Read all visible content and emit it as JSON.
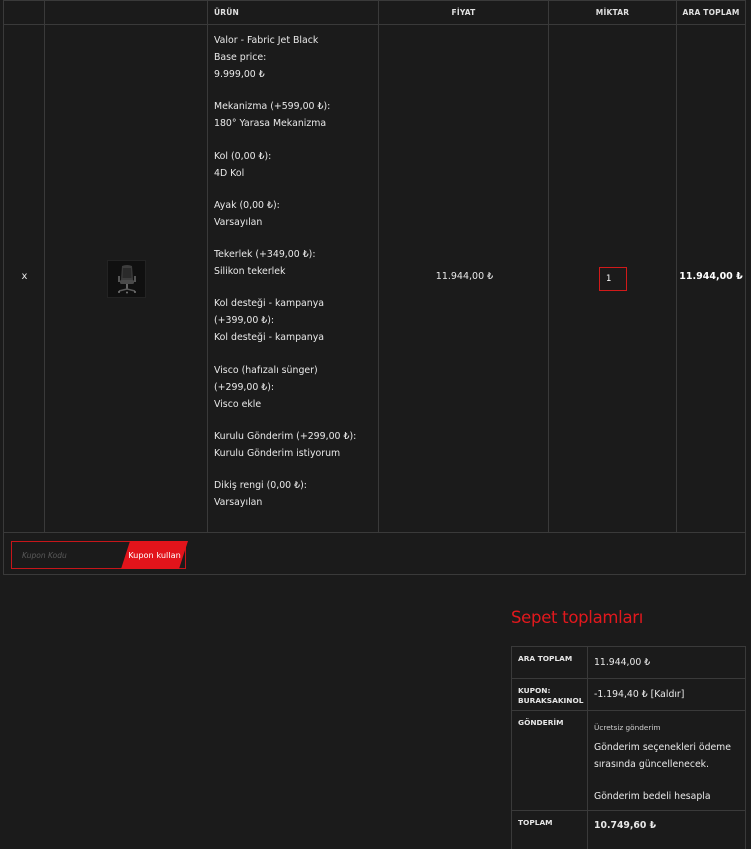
{
  "cart": {
    "headers": {
      "product": "ÜRÜN",
      "price": "FİYAT",
      "quantity": "MİKTAR",
      "subtotal": "ARA TOPLAM"
    },
    "item": {
      "remove": "x",
      "thumbnail_icon": "office-chair-icon",
      "lines": [
        [
          "Valor - Fabric Jet Black",
          "Base price:",
          "9.999,00 ₺"
        ],
        [
          "Mekanizma (+599,00 ₺):",
          "180° Yarasa Mekanizma"
        ],
        [
          "Kol (0,00 ₺):",
          "4D Kol"
        ],
        [
          "Ayak (0,00 ₺):",
          "Varsayılan"
        ],
        [
          "Tekerlek (+349,00 ₺):",
          "Silikon tekerlek"
        ],
        [
          "Kol desteği - kampanya",
          "(+399,00 ₺):",
          "Kol desteği - kampanya"
        ],
        [
          "Visco (hafızalı sünger)",
          "(+299,00 ₺):",
          "Visco ekle"
        ],
        [
          "Kurulu Gönderim (+299,00 ₺):",
          "Kurulu Gönderim istiyorum"
        ],
        [
          "Dikiş rengi (0,00 ₺):",
          "Varsayılan"
        ]
      ],
      "price": "11.944,00 ₺",
      "quantity": "1",
      "subtotal": "11.944,00 ₺"
    },
    "coupon": {
      "placeholder": "Kupon Kodu",
      "button": "Kupon kullan"
    }
  },
  "totals": {
    "title": "Sepet toplamları",
    "subtotal_label": "ARA TOPLAM",
    "subtotal_value": "11.944,00 ₺",
    "coupon_label": "KUPON: BURAKSAKINOL",
    "coupon_value": "-1.194,40 ₺",
    "coupon_remove": "[Kaldır]",
    "shipping_label": "GÖNDERİM",
    "shipping_free": "Ücretsiz gönderim",
    "shipping_note": "Gönderim seçenekleri ödeme sırasında güncellenecek.",
    "shipping_calc": "Gönderim bedeli hesapla",
    "total_label": "TOPLAM",
    "total_value": "10.749,60 ₺"
  },
  "colors": {
    "accent": "#e2141b",
    "background": "#1b1b1b",
    "border": "#3a3a3a"
  }
}
